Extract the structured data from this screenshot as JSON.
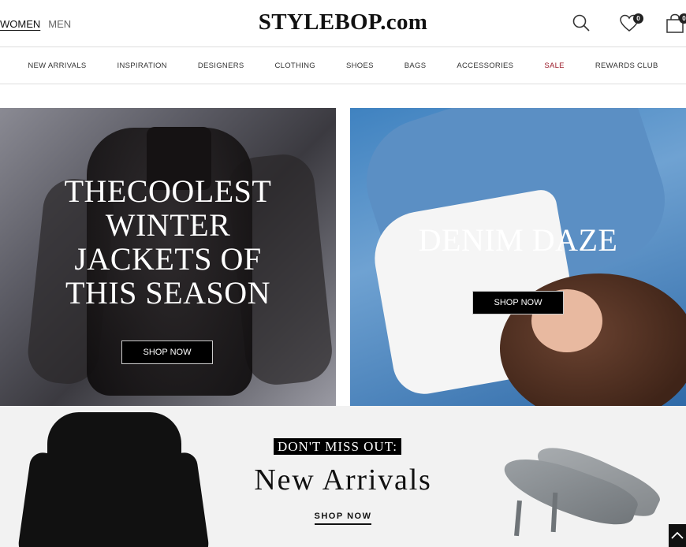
{
  "header": {
    "gender_tabs": [
      {
        "label": "WOMEN",
        "active": true
      },
      {
        "label": "MEN",
        "active": false
      }
    ],
    "logo": "STYLEBOP.com",
    "icons": [
      "search-icon",
      "heart-icon",
      "bag-icon"
    ],
    "wishlist_count": "0",
    "bag_count": "0"
  },
  "nav": {
    "items": [
      {
        "label": "NEW ARRIVALS"
      },
      {
        "label": "INSPIRATION"
      },
      {
        "label": "DESIGNERS"
      },
      {
        "label": "CLOTHING"
      },
      {
        "label": "SHOES"
      },
      {
        "label": "BAGS"
      },
      {
        "label": "ACCESSORIES"
      },
      {
        "label": "SALE"
      },
      {
        "label": "REWARDS CLUB"
      }
    ],
    "sale_color": "#9b1b2a"
  },
  "banners": {
    "left": {
      "title_lines": [
        "THECOOLEST",
        "WINTER",
        "JACKETS OF",
        "THIS SEASON"
      ],
      "cta": "SHOP NOW"
    },
    "right": {
      "title": "DENIM DAZE",
      "cta": "SHOP NOW"
    }
  },
  "promo": {
    "tag": "DON'T MISS OUT:",
    "title": "New Arrivals",
    "cta": "SHOP NOW"
  }
}
